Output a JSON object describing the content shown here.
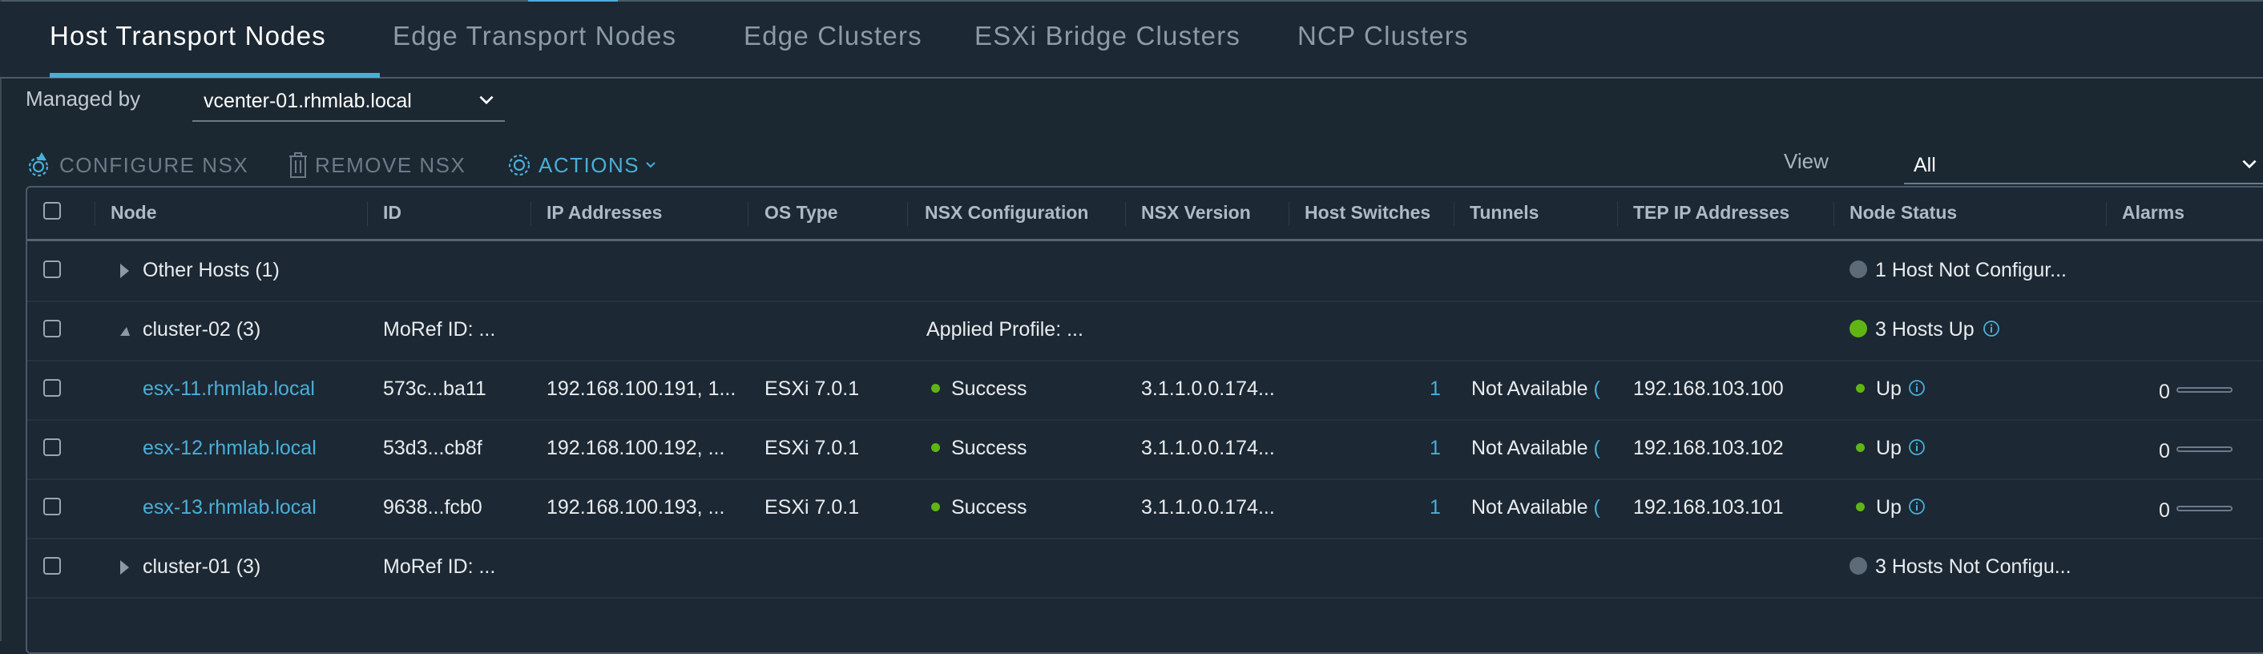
{
  "tabs": [
    {
      "label": "Host Transport Nodes",
      "active": true
    },
    {
      "label": "Edge Transport Nodes",
      "active": false
    },
    {
      "label": "Edge Clusters",
      "active": false
    },
    {
      "label": "ESXi Bridge Clusters",
      "active": false
    },
    {
      "label": "NCP Clusters",
      "active": false
    }
  ],
  "filter": {
    "managed_by_label": "Managed by",
    "managed_by_value": "vcenter-01.rhmlab.local",
    "view_label": "View",
    "view_value": "All"
  },
  "toolbar": {
    "configure_label": "CONFIGURE NSX",
    "remove_label": "REMOVE NSX",
    "actions_label": "ACTIONS",
    "actions_chevron": "⌄"
  },
  "table": {
    "columns": [
      "Node",
      "ID",
      "IP Addresses",
      "OS Type",
      "NSX Configuration",
      "NSX Version",
      "Host Switches",
      "Tunnels",
      "TEP IP Addresses",
      "Node Status",
      "Alarms"
    ],
    "rows": [
      {
        "type": "group",
        "expanded": false,
        "node": "Other Hosts (1)",
        "id": "",
        "nsx_config": "",
        "status": "1 Host Not Configur...",
        "status_color": "#5d6b78",
        "status_info": false
      },
      {
        "type": "group",
        "expanded": true,
        "node": "cluster-02 (3)",
        "id": "MoRef ID: ...",
        "nsx_config": "Applied Profile:  ...",
        "status": "3 Hosts Up",
        "status_color": "#60b515",
        "status_info": true
      },
      {
        "type": "host",
        "node": "esx-11.rhmlab.local",
        "id": "573c...ba11",
        "ip": "192.168.100.191, 1...",
        "os": "ESXi 7.0.1",
        "nsx_config": "Success",
        "nsx_version": "3.1.1.0.0.174...",
        "host_switches": "1",
        "tunnels": "Not Available",
        "tunnels_paren": "(",
        "tep": "192.168.103.100",
        "status": "Up",
        "alarms": "0"
      },
      {
        "type": "host",
        "node": "esx-12.rhmlab.local",
        "id": "53d3...cb8f",
        "ip": "192.168.100.192, ...",
        "os": "ESXi 7.0.1",
        "nsx_config": "Success",
        "nsx_version": "3.1.1.0.0.174...",
        "host_switches": "1",
        "tunnels": "Not Available",
        "tunnels_paren": "(",
        "tep": "192.168.103.102",
        "status": "Up",
        "alarms": "0"
      },
      {
        "type": "host",
        "node": "esx-13.rhmlab.local",
        "id": "9638...fcb0",
        "ip": "192.168.100.193, ...",
        "os": "ESXi 7.0.1",
        "nsx_config": "Success",
        "nsx_version": "3.1.1.0.0.174...",
        "host_switches": "1",
        "tunnels": "Not Available",
        "tunnels_paren": "(",
        "tep": "192.168.103.101",
        "status": "Up",
        "alarms": "0"
      },
      {
        "type": "group",
        "expanded": false,
        "node": "cluster-01 (3)",
        "id": "MoRef ID: ...",
        "nsx_config": "",
        "status": "3 Hosts Not Configu...",
        "status_color": "#5d6b78",
        "status_info": false
      }
    ]
  },
  "colors": {
    "accent": "#49afd9",
    "success": "#60b515",
    "not_configured": "#5d6b78",
    "background": "#1b2731"
  }
}
